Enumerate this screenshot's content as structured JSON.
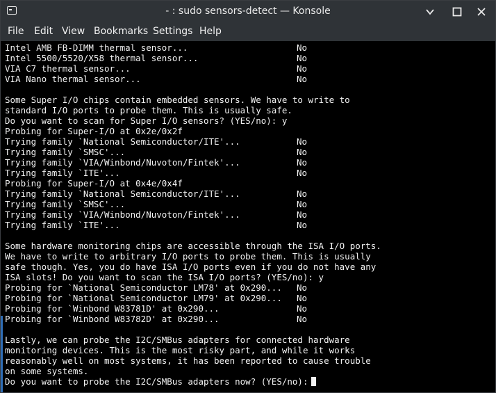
{
  "window": {
    "title": "- : sudo sensors-detect — Konsole",
    "app_icon": "terminal-icon",
    "controls": {
      "minimize": "minimize-icon",
      "maximize": "maximize-icon",
      "close": "close-icon"
    }
  },
  "menu": {
    "items": [
      "File",
      "Edit",
      "View",
      "Bookmarks",
      "Settings",
      "Help"
    ]
  },
  "terminal": {
    "lines": [
      {
        "text": "Intel AMB FB-DIMM thermal sensor...",
        "result": "No"
      },
      {
        "text": "Intel 5500/5520/X58 thermal sensor...",
        "result": "No"
      },
      {
        "text": "VIA C7 thermal sensor...",
        "result": "No"
      },
      {
        "text": "VIA Nano thermal sensor...",
        "result": "No"
      },
      {
        "text": "",
        "result": ""
      },
      {
        "text": "Some Super I/O chips contain embedded sensors. We have to write to",
        "result": ""
      },
      {
        "text": "standard I/O ports to probe them. This is usually safe.",
        "result": ""
      },
      {
        "text": "Do you want to scan for Super I/O sensors? (YES/no): y",
        "result": ""
      },
      {
        "text": "Probing for Super-I/O at 0x2e/0x2f",
        "result": ""
      },
      {
        "text": "Trying family `National Semiconductor/ITE'...",
        "result": "No"
      },
      {
        "text": "Trying family `SMSC'...",
        "result": "No"
      },
      {
        "text": "Trying family `VIA/Winbond/Nuvoton/Fintek'...",
        "result": "No"
      },
      {
        "text": "Trying family `ITE'...",
        "result": "No"
      },
      {
        "text": "Probing for Super-I/O at 0x4e/0x4f",
        "result": ""
      },
      {
        "text": "Trying family `National Semiconductor/ITE'...",
        "result": "No"
      },
      {
        "text": "Trying family `SMSC'...",
        "result": "No"
      },
      {
        "text": "Trying family `VIA/Winbond/Nuvoton/Fintek'...",
        "result": "No"
      },
      {
        "text": "Trying family `ITE'...",
        "result": "No"
      },
      {
        "text": "",
        "result": ""
      },
      {
        "text": "Some hardware monitoring chips are accessible through the ISA I/O ports.",
        "result": ""
      },
      {
        "text": "We have to write to arbitrary I/O ports to probe them. This is usually",
        "result": ""
      },
      {
        "text": "safe though. Yes, you do have ISA I/O ports even if you do not have any",
        "result": ""
      },
      {
        "text": "ISA slots! Do you want to scan the ISA I/O ports? (YES/no): y",
        "result": ""
      },
      {
        "text": "Probing for `National Semiconductor LM78' at 0x290...",
        "result": "No"
      },
      {
        "text": "Probing for `National Semiconductor LM79' at 0x290...",
        "result": "No"
      },
      {
        "text": "Probing for `Winbond W83781D' at 0x290...",
        "result": "No"
      },
      {
        "text": "Probing for `Winbond W83782D' at 0x290...",
        "result": "No"
      },
      {
        "text": "",
        "result": ""
      },
      {
        "text": "Lastly, we can probe the I2C/SMBus adapters for connected hardware",
        "result": ""
      },
      {
        "text": "monitoring devices. This is the most risky part, and while it works",
        "result": ""
      },
      {
        "text": "reasonably well on most systems, it has been reported to cause trouble",
        "result": ""
      },
      {
        "text": "on some systems.",
        "result": ""
      },
      {
        "text": "Do you want to probe the I2C/SMBus adapters now? (YES/no):",
        "result": ""
      }
    ]
  },
  "colors": {
    "titlebar_bg": "#2f3337",
    "terminal_bg": "#000000",
    "terminal_fg": "#f2f2f2",
    "accent": "#2f6db5"
  }
}
